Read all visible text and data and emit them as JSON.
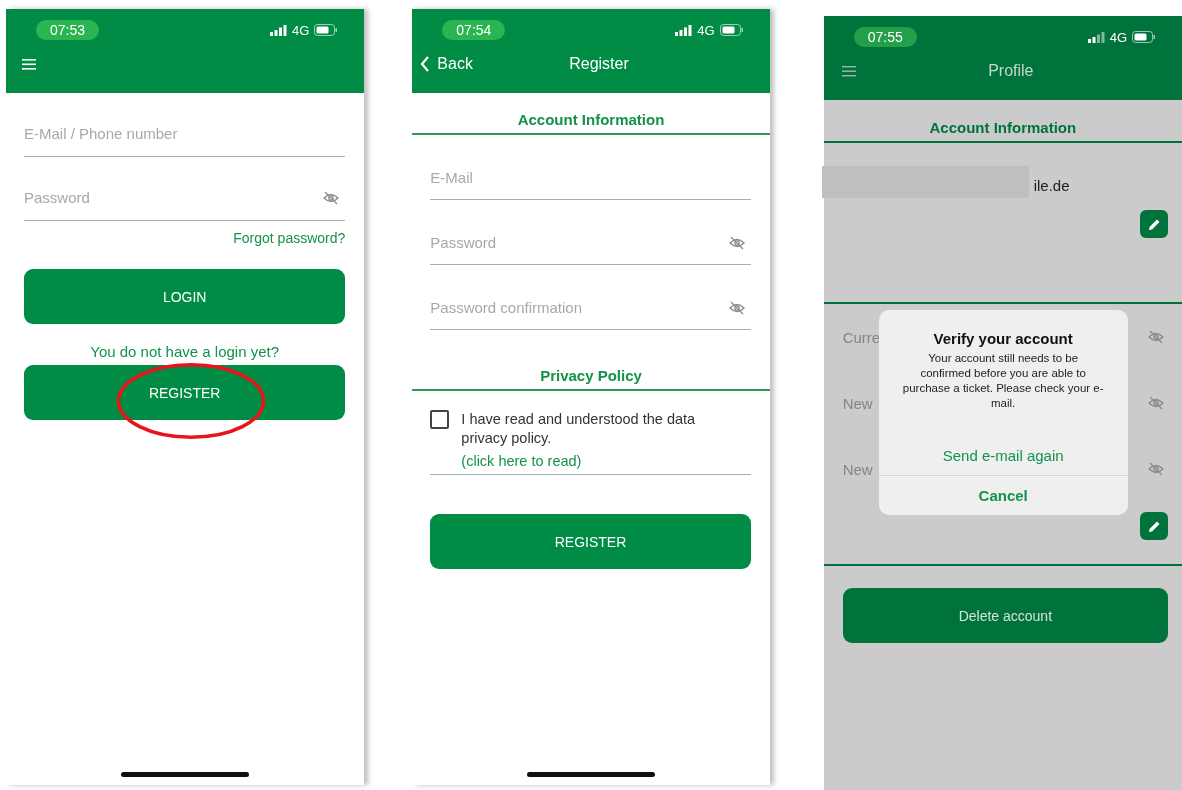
{
  "login_screen": {
    "status": {
      "time": "07:53",
      "network": "4G"
    },
    "fields": [
      {
        "placeholder": "E-Mail / Phone number",
        "kind": "text"
      },
      {
        "placeholder": "Password",
        "kind": "password"
      }
    ],
    "forgot_link": "Forgot password?",
    "login_button": "LOGIN",
    "no_login_text": "You do not have a login yet?",
    "register_button": "REGISTER"
  },
  "register_screen": {
    "status": {
      "time": "07:54",
      "network": "4G"
    },
    "back_label": "Back",
    "title": "Register",
    "account_heading": "Account Information",
    "fields": [
      {
        "placeholder": "E-Mail",
        "kind": "text"
      },
      {
        "placeholder": "Password",
        "kind": "password"
      },
      {
        "placeholder": "Password confirmation",
        "kind": "password"
      }
    ],
    "privacy_heading": "Privacy Policy",
    "consent": {
      "label": "I have read and understood the data privacy policy.",
      "checked": false,
      "link": "(click here to read)"
    },
    "register_button": "REGISTER"
  },
  "profile_screen": {
    "status": {
      "time": "07:55",
      "network": "4G"
    },
    "title": "Profile",
    "account_heading": "Account Information",
    "email_value": "ile.de",
    "password_fields": [
      {
        "placeholder": "Curre"
      },
      {
        "placeholder": "New"
      },
      {
        "placeholder": "New"
      }
    ],
    "delete_button": "Delete account"
  },
  "dialog": {
    "title": "Verify your account",
    "message": "Your account still needs to be confirmed before you are able to purchase a ticket. Please check your e-mail.",
    "actions": [
      {
        "label": "Send e-mail again",
        "kind": "default"
      },
      {
        "label": "Cancel",
        "kind": "cancel"
      }
    ]
  }
}
